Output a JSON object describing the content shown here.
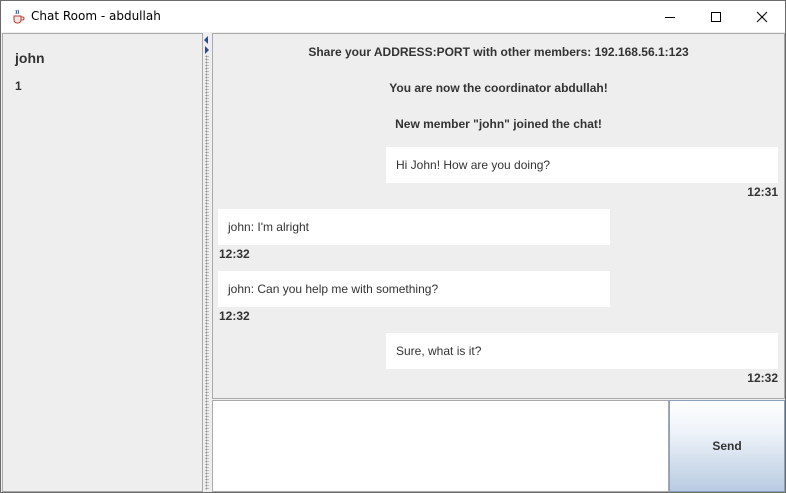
{
  "window": {
    "title": "Chat Room - abdullah",
    "icon": "java-cup-icon"
  },
  "sidebar": {
    "members": [
      {
        "name": "john",
        "count": "1"
      }
    ]
  },
  "chat": {
    "system_messages": [
      "Share your ADDRESS:PORT with other members: 192.168.56.1:123",
      "You are now the coordinator abdullah!",
      "New member \"john\" joined the chat!"
    ],
    "messages": [
      {
        "text": "Hi John! How are you doing?",
        "time": "12:31",
        "side": "right"
      },
      {
        "text": "john: I'm alright",
        "time": "12:32",
        "side": "left"
      },
      {
        "text": "john: Can you help me with something?",
        "time": "12:32",
        "side": "left"
      },
      {
        "text": "Sure, what is it?",
        "time": "12:32",
        "side": "right"
      }
    ]
  },
  "composer": {
    "value": "",
    "send_label": "Send"
  },
  "colors": {
    "bubble": "#ffffff",
    "panel": "#eeeeee",
    "send_gradient_bottom": "#b9cbe2"
  }
}
